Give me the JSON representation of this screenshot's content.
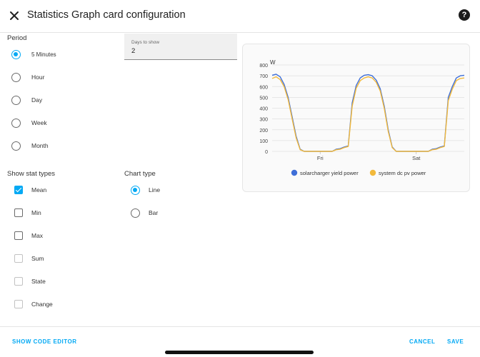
{
  "header": {
    "title": "Statistics Graph card configuration",
    "help_label": "?"
  },
  "period": {
    "label": "Period",
    "options": [
      "5 Minutes",
      "Hour",
      "Day",
      "Week",
      "Month"
    ],
    "selected": "5 Minutes"
  },
  "days": {
    "label": "Days to show",
    "value": "2"
  },
  "stat_types": {
    "label": "Show stat types",
    "items": [
      {
        "label": "Mean",
        "checked": true,
        "enabled": true
      },
      {
        "label": "Min",
        "checked": false,
        "enabled": true
      },
      {
        "label": "Max",
        "checked": false,
        "enabled": true
      },
      {
        "label": "Sum",
        "checked": false,
        "enabled": false
      },
      {
        "label": "State",
        "checked": false,
        "enabled": false
      },
      {
        "label": "Change",
        "checked": false,
        "enabled": false
      }
    ]
  },
  "chart_type": {
    "label": "Chart type",
    "options": [
      "Line",
      "Bar"
    ],
    "selected": "Line"
  },
  "footer": {
    "code_editor": "SHOW CODE EDITOR",
    "cancel": "CANCEL",
    "save": "SAVE"
  },
  "colors": {
    "accent": "#03a9f4",
    "series1": "#3f6fd8",
    "series2": "#f2b93b"
  },
  "chart_data": {
    "type": "line",
    "ylabel": "W",
    "ylim": [
      0,
      800
    ],
    "yticks": [
      0,
      100,
      200,
      300,
      400,
      500,
      600,
      700,
      800
    ],
    "xlim": [
      0,
      48
    ],
    "xticks": [
      {
        "x": 12,
        "label": "Fri"
      },
      {
        "x": 36,
        "label": "Sat"
      }
    ],
    "grid": true,
    "legend_position": "bottom",
    "series": [
      {
        "name": "solarcharger yield power",
        "color": "#3f6fd8",
        "x": [
          0,
          1,
          2,
          3,
          4,
          5,
          6,
          7,
          8,
          9,
          12,
          15,
          16,
          17,
          18,
          19,
          20,
          21,
          22,
          23,
          24,
          25,
          26,
          27,
          28,
          29,
          30,
          31,
          32,
          33,
          36,
          39,
          40,
          41,
          42,
          43,
          44,
          45,
          46,
          47,
          48
        ],
        "values": [
          705,
          715,
          690,
          620,
          500,
          320,
          140,
          20,
          0,
          0,
          0,
          0,
          20,
          25,
          40,
          50,
          450,
          610,
          680,
          705,
          710,
          700,
          660,
          580,
          420,
          200,
          40,
          0,
          0,
          0,
          0,
          0,
          20,
          25,
          40,
          50,
          500,
          600,
          680,
          700,
          705
        ]
      },
      {
        "name": "system dc pv power",
        "color": "#f2b93b",
        "x": [
          0,
          1,
          2,
          3,
          4,
          5,
          6,
          7,
          8,
          9,
          12,
          15,
          16,
          17,
          18,
          19,
          20,
          21,
          22,
          23,
          24,
          25,
          26,
          27,
          28,
          29,
          30,
          31,
          32,
          33,
          36,
          39,
          40,
          41,
          42,
          43,
          44,
          45,
          46,
          47,
          48
        ],
        "values": [
          675,
          690,
          665,
          600,
          480,
          300,
          125,
          15,
          0,
          0,
          0,
          0,
          15,
          20,
          35,
          45,
          420,
          585,
          655,
          680,
          690,
          680,
          640,
          560,
          400,
          185,
          35,
          0,
          0,
          0,
          0,
          0,
          15,
          20,
          35,
          45,
          470,
          575,
          655,
          675,
          680
        ]
      }
    ]
  }
}
